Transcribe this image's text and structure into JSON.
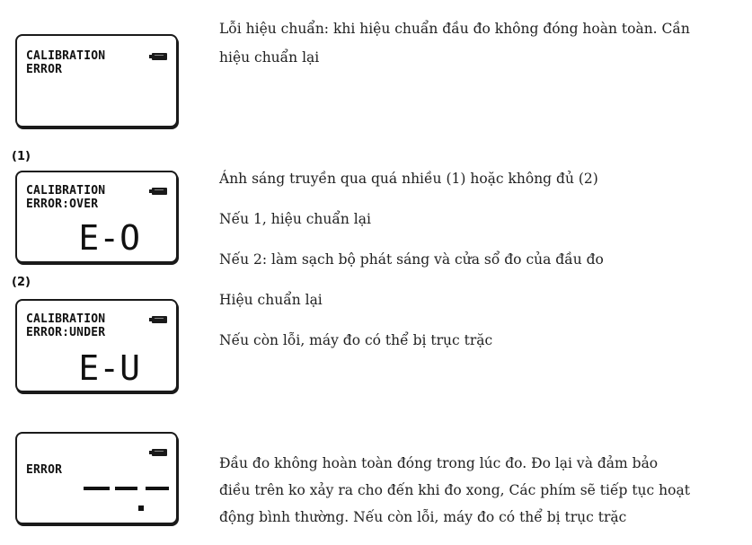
{
  "displays": [
    {
      "line1": "CALIBRATION",
      "line2": "ERROR"
    },
    {
      "label": "(1)",
      "line1": "CALIBRATION",
      "line2": "ERROR:OVER",
      "code": "E-O"
    },
    {
      "label": "(2)",
      "line1": "CALIBRATION",
      "line2": "ERROR:UNDER",
      "code": "E-U"
    },
    {
      "line1": "ERROR"
    }
  ],
  "descriptions": {
    "calibration_error_line1": "Lỗi hiệu chuẩn: khi hiệu chuẩn đầu đo không đóng hoàn toàn. Cần",
    "calibration_error_line2": "hiệu chuẩn lại",
    "over_under_light": "Ánh sáng truyền qua quá nhiều (1) hoặc không đủ (2)",
    "case_1": "Nếu 1, hiệu chuẩn lại",
    "case_2": "Nếu 2: làm sạch bộ phát sáng và cửa sổ đo của đầu đo",
    "recalibrate": "Hiệu chuẩn lại",
    "still_error": "Nếu còn lỗi, máy đo có thể bị trục trặc",
    "probe_open_line1": "Đầu đo không hoàn toàn đóng trong lúc đo. Đo lại và đảm bảo",
    "probe_open_line2": "điều trên ko xảy ra cho đến khi đo xong, Các phím sẽ tiếp tục hoạt",
    "probe_open_line3": "động bình thường. Nếu còn lỗi, máy đo có thể bị trục trặc"
  },
  "icons": [
    "battery-icon"
  ]
}
